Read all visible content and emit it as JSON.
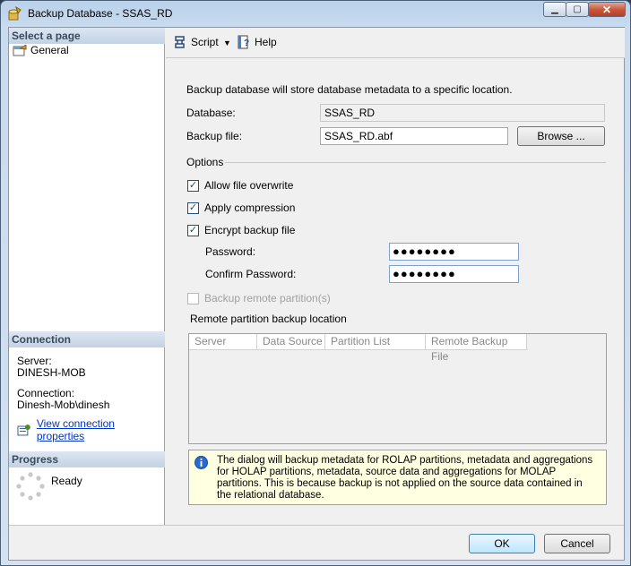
{
  "window": {
    "title": "Backup Database - SSAS_RD",
    "minimize_icon": "minimize-icon",
    "maximize_icon": "maximize-icon",
    "close_icon": "close-icon"
  },
  "left": {
    "select_page_header": "Select a page",
    "pages": [
      {
        "label": "General",
        "icon": "properties-page-icon"
      }
    ],
    "connection_header": "Connection",
    "server_label": "Server:",
    "server_value": "DINESH-MOB",
    "connection_label": "Connection:",
    "connection_value": "Dinesh-Mob\\dinesh",
    "view_connection_link": "View connection properties",
    "progress_header": "Progress",
    "progress_status": "Ready"
  },
  "toolbar": {
    "script_label": "Script",
    "help_label": "Help"
  },
  "form": {
    "description": "Backup database will store database metadata to a specific location.",
    "database_label": "Database:",
    "database_value": "SSAS_RD",
    "backup_file_label": "Backup file:",
    "backup_file_value": "SSAS_RD.abf",
    "browse_label": "Browse ...",
    "options_label": "Options",
    "allow_overwrite_label": "Allow file overwrite",
    "allow_overwrite_checked": true,
    "apply_compression_label": "Apply compression",
    "apply_compression_checked": true,
    "encrypt_label": "Encrypt backup file",
    "encrypt_checked": true,
    "password_label": "Password:",
    "password_value": "●●●●●●●●",
    "confirm_password_label": "Confirm Password:",
    "confirm_password_value": "●●●●●●●●",
    "backup_remote_label": "Backup remote partition(s)",
    "backup_remote_checked": false,
    "remote_location_label": "Remote partition backup location",
    "grid_columns": [
      "Server",
      "Data Source",
      "Partition List",
      "Remote Backup File"
    ],
    "info_text": "The dialog will backup metadata for ROLAP partitions, metadata and aggregations for HOLAP partitions, metadata, source data and aggregations for MOLAP partitions. This is because backup is not applied on the source data contained in the relational database."
  },
  "buttons": {
    "ok_label": "OK",
    "cancel_label": "Cancel"
  }
}
